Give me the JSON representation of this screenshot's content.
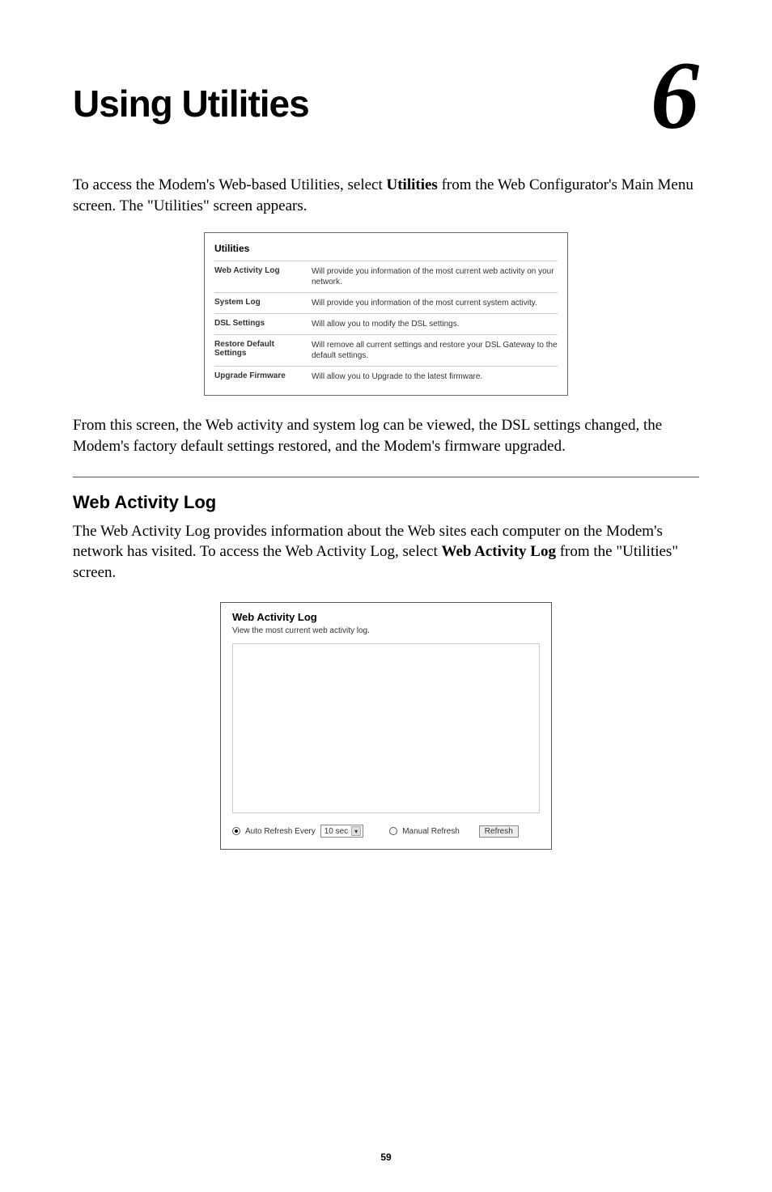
{
  "chapter": {
    "title": "Using Utilities",
    "number": "6"
  },
  "intro": {
    "prefix": "To access the Modem's Web-based Utilities, select ",
    "bold": "Utilities",
    "suffix": " from the Web Configurator's Main Menu screen. The \"Utilities\" screen appears."
  },
  "utilities_table": {
    "heading": "Utilities",
    "rows": [
      {
        "label": "Web Activity Log",
        "desc": "Will provide you information of the most current web activity on your network."
      },
      {
        "label": "System Log",
        "desc": "Will provide you information of the most current system activity."
      },
      {
        "label": "DSL Settings",
        "desc": "Will allow you to modify the DSL settings."
      },
      {
        "label": "Restore Default Settings",
        "desc": "Will remove all current settings and restore your DSL Gateway to the default settings."
      },
      {
        "label": "Upgrade Firmware",
        "desc": "Will allow you to Upgrade to the latest firmware."
      }
    ]
  },
  "mid_text": "From this screen, the Web activity and system log can be viewed, the DSL settings changed, the Modem's factory default settings restored, and the Modem's firmware upgraded.",
  "section": {
    "heading": "Web Activity Log",
    "text_prefix": "The Web Activity Log provides information about the Web sites each computer on the Modem's network has visited. To access the Web Activity Log, select ",
    "text_bold": "Web Activity Log",
    "text_suffix": " from the \"Utilities\" screen."
  },
  "wal_box": {
    "title": "Web Activity Log",
    "subtitle": "View the most current web activity log.",
    "auto_label": "Auto Refresh Every",
    "auto_value": "10 sec",
    "manual_label": "Manual Refresh",
    "button": "Refresh"
  },
  "page_number": "59"
}
